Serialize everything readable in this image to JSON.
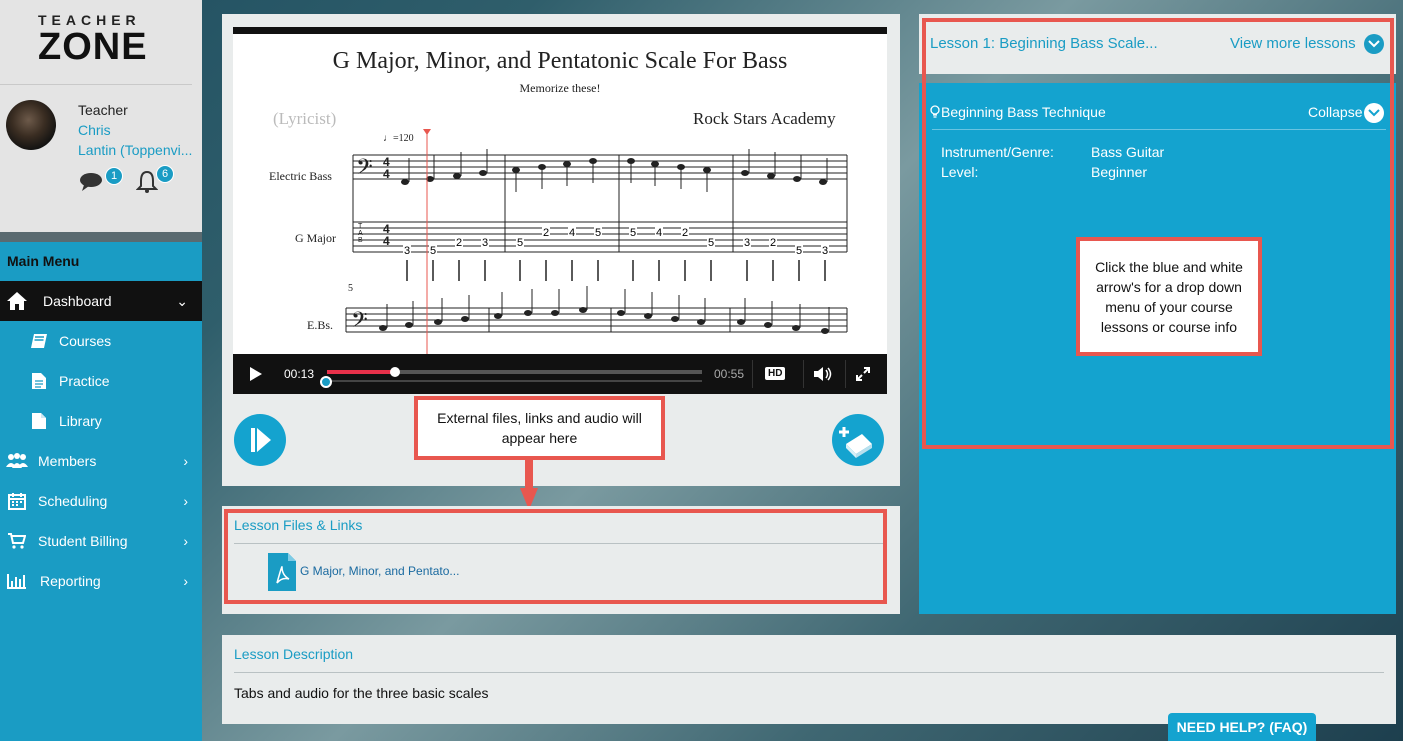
{
  "brand": {
    "logo_top": "TEACHER",
    "logo_main": "ZONE"
  },
  "profile": {
    "role": "Teacher",
    "name_first": "Chris",
    "name_last": "Lantin (Toppenvi...",
    "messages_count": "1",
    "notifications_count": "6"
  },
  "sidebar": {
    "menu_label": "Main Menu",
    "items": [
      {
        "label": "Dashboard",
        "icon": "home-icon"
      },
      {
        "label": "Courses",
        "icon": "book-icon"
      },
      {
        "label": "Practice",
        "icon": "document-icon"
      },
      {
        "label": "Library",
        "icon": "file-icon"
      },
      {
        "label": "Members",
        "icon": "users-icon"
      },
      {
        "label": "Scheduling",
        "icon": "calendar-icon"
      },
      {
        "label": "Student Billing",
        "icon": "cart-icon"
      },
      {
        "label": "Reporting",
        "icon": "bar-chart-icon"
      }
    ]
  },
  "sheet": {
    "title": "G Major, Minor, and Pentatonic Scale For Bass",
    "subtitle": "Memorize these!",
    "lyricist": "(Lyricist)",
    "composer": "Rock Stars Academy",
    "tempo": "♩=120",
    "staff1_label": "Electric Bass",
    "staff2_label": "G Major",
    "staff3_label": "E.Bs.",
    "measure_number": "5",
    "tab_letters": [
      "T",
      "A",
      "B"
    ],
    "tab_numbers": [
      "3",
      "5",
      "2",
      "3",
      "5",
      "2",
      "4",
      "5",
      "5",
      "4",
      "2",
      "5",
      "3",
      "2",
      "5",
      "3"
    ]
  },
  "video": {
    "current_time": "00:13",
    "duration": "00:55",
    "quality": "HD",
    "progress": 0.18
  },
  "callouts": {
    "files_note": "External files, links and audio will appear here",
    "arrow_note": "Click the blue and white arrow's for a drop down menu of your course lessons or course info"
  },
  "files": {
    "title": "Lesson Files & Links",
    "file_name": "G Major, Minor, and Pentato..."
  },
  "lesson": {
    "title": "Lesson 1: Beginning Bass Scale...",
    "more_label": "View more lessons",
    "technique_title": "Beginning Bass Technique",
    "collapse_label": "Collapse",
    "instrument_label": "Instrument/Genre:",
    "instrument_value": "Bass Guitar",
    "level_label": "Level:",
    "level_value": "Beginner"
  },
  "description": {
    "title": "Lesson Description",
    "text": "Tabs and audio for the three basic scales"
  },
  "help": {
    "label": "NEED HELP? (FAQ)"
  },
  "colors": {
    "accent": "#1a9cc4",
    "callout_border": "#e8574f",
    "progress": "#e8314a"
  }
}
